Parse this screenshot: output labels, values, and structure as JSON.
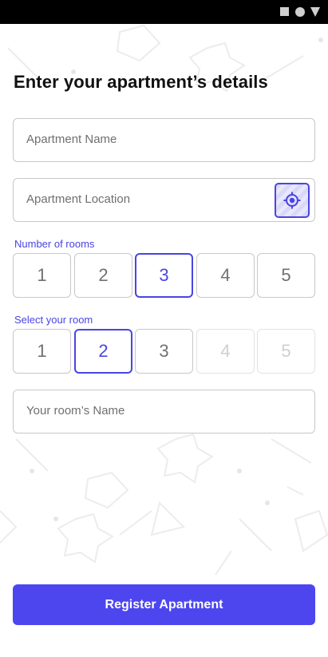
{
  "title": "Enter your apartment’s details",
  "fields": {
    "apartment_name_placeholder": "Apartment Name",
    "apartment_location_placeholder": "Apartment Location",
    "room_name_placeholder": "Your room’s Name"
  },
  "number_of_rooms": {
    "label": "Number of rooms",
    "options": [
      "1",
      "2",
      "3",
      "4",
      "5"
    ],
    "selected": "3"
  },
  "select_room": {
    "label": "Select your room",
    "options": [
      "1",
      "2",
      "3",
      "4",
      "5"
    ],
    "selected": "2",
    "disabled": [
      "4",
      "5"
    ]
  },
  "submit_label": "Register Apartment",
  "colors": {
    "accent": "#4a45e0",
    "button": "#4d46ef",
    "status_bar": "#000000"
  },
  "icons": {
    "location": "crosshair-icon",
    "status_bar": [
      "square-icon",
      "circle-icon",
      "triangle-icon"
    ]
  }
}
